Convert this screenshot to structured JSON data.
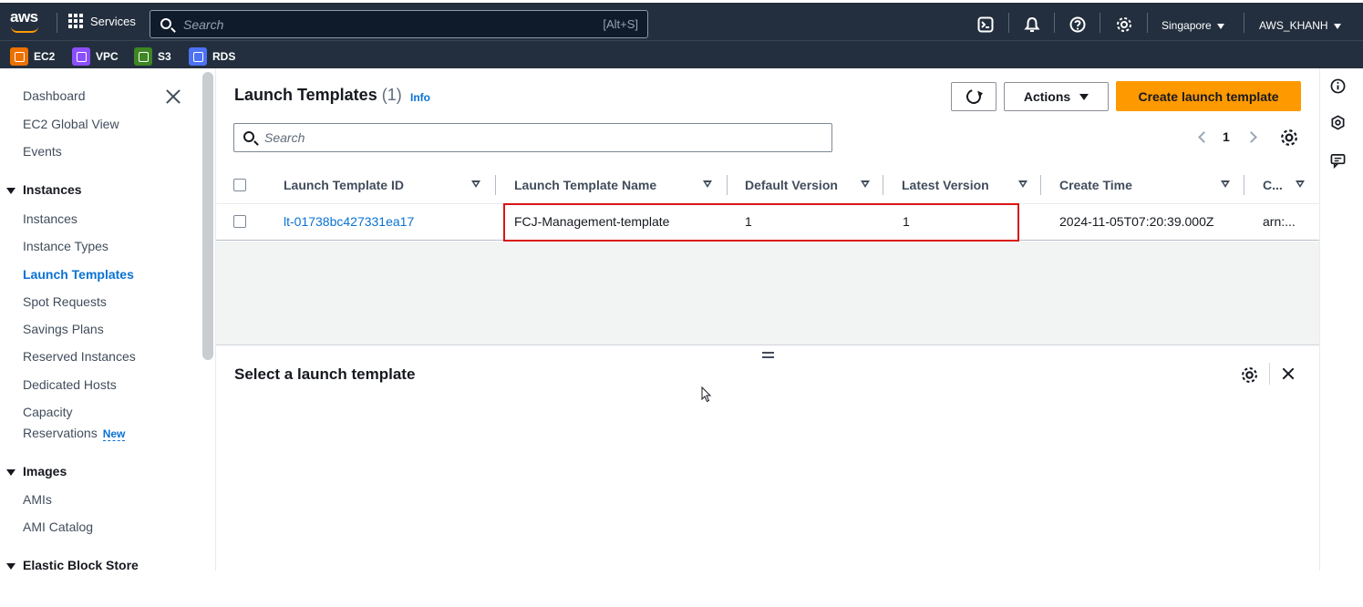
{
  "topnav": {
    "logo": "aws",
    "services": "Services",
    "search_placeholder": "Search",
    "search_shortcut": "[Alt+S]",
    "region": "Singapore",
    "account": "AWS_KHANH",
    "icons": [
      "cloudshell-icon",
      "bell-icon",
      "help-icon",
      "settings-icon"
    ]
  },
  "shortcuts": [
    {
      "label": "EC2",
      "color": "#ed7100"
    },
    {
      "label": "VPC",
      "color": "#8c4fff"
    },
    {
      "label": "S3",
      "color": "#3f8624"
    },
    {
      "label": "RDS",
      "color": "#4d72f3"
    }
  ],
  "sidebar": {
    "items_top": [
      "Dashboard",
      "EC2 Global View",
      "Events"
    ],
    "instances_header": "Instances",
    "instances_items": [
      "Instances",
      "Instance Types",
      "Launch Templates",
      "Spot Requests",
      "Savings Plans",
      "Reserved Instances",
      "Dedicated Hosts",
      "Capacity",
      "Reservations"
    ],
    "new_badge": "New",
    "images_header": "Images",
    "images_items": [
      "AMIs",
      "AMI Catalog"
    ],
    "ebs_header": "Elastic Block Store"
  },
  "main": {
    "title": "Launch Templates",
    "count": "(1)",
    "info": "Info",
    "actions_label": "Actions",
    "create_label": "Create launch template",
    "search_placeholder": "Search",
    "page": "1"
  },
  "table": {
    "columns": [
      "Launch Template ID",
      "Launch Template Name",
      "Default Version",
      "Latest Version",
      "Create Time",
      "C..."
    ],
    "rows": [
      {
        "id": "lt-01738bc427331ea17",
        "name": "FCJ-Management-template",
        "default_version": "1",
        "latest_version": "1",
        "create_time": "2024-11-05T07:20:39.000Z",
        "owner": "arn:..."
      }
    ]
  },
  "split_panel": {
    "title": "Select a launch template"
  },
  "colors": {
    "nav_bg": "#232f3e",
    "primary": "#ff9900",
    "link": "#0972d3",
    "highlight": "#d91515"
  }
}
